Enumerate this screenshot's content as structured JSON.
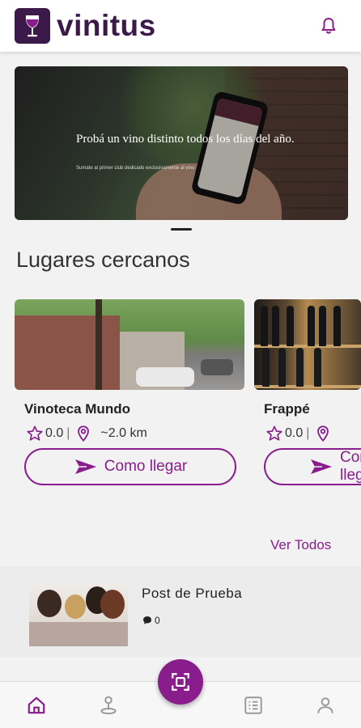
{
  "header": {
    "brand": "vinitus",
    "logo_icon": "wine-glass-icon",
    "notification_icon": "bell-icon"
  },
  "banner": {
    "headline": "Probá un vino distinto todos los días del año.",
    "subtext": "Sumate al primer club dedicado exclusivamente al vino"
  },
  "nearby": {
    "title": "Lugares cercanos",
    "places": [
      {
        "name": "Vinoteca Mundo",
        "rating": "0.0",
        "separator": "|",
        "distance": "~2.0 km",
        "button": "Como llegar"
      },
      {
        "name": "Frappé",
        "rating": "0.0",
        "separator": "|",
        "distance": "",
        "button": "Como llegar"
      }
    ],
    "see_all": "Ver Todos"
  },
  "post": {
    "title": "Post  de Prueba",
    "comments": "0",
    "comment_icon": "comment-icon"
  },
  "bottom_nav": {
    "items": [
      "home-icon",
      "map-pin-icon",
      "scan-icon",
      "menu-list-icon",
      "profile-icon"
    ],
    "active": "home-icon"
  },
  "colors": {
    "accent": "#8a1d8c",
    "brand_dark": "#3b1a4a"
  }
}
